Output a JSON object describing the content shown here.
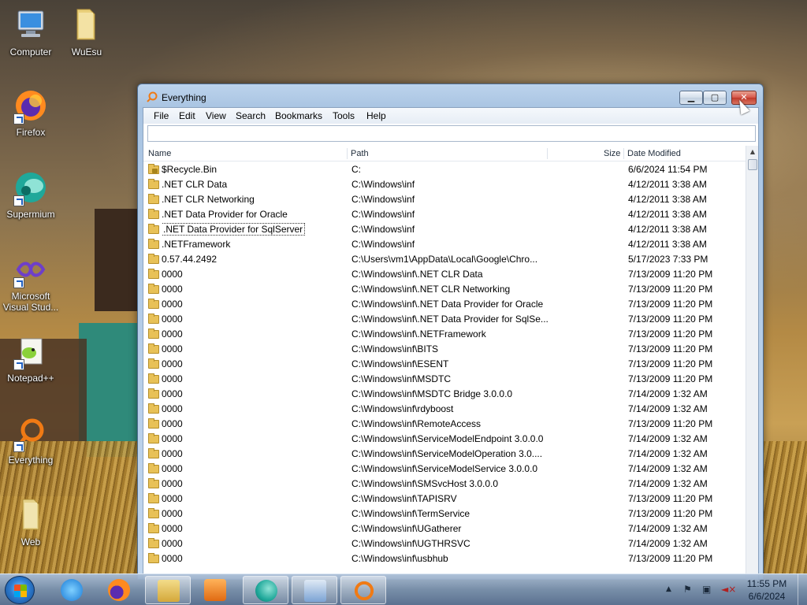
{
  "desktop": {
    "icons": [
      {
        "label": "Computer"
      },
      {
        "label": "WuEsu"
      },
      {
        "label": "Firefox"
      },
      {
        "label": "Supermium"
      },
      {
        "label": "Microsoft Visual Stud..."
      },
      {
        "label": "Notepad++"
      },
      {
        "label": "Everything"
      },
      {
        "label": "Web"
      }
    ]
  },
  "window": {
    "title": "Everything",
    "minimize_glyph": "▁",
    "maximize_glyph": "▢",
    "close_glyph": "✕",
    "menu": [
      "File",
      "Edit",
      "View",
      "Search",
      "Bookmarks",
      "Tools",
      "Help"
    ],
    "search": {
      "value": "",
      "placeholder": ""
    },
    "columns": {
      "name": "Name",
      "path": "Path",
      "size": "Size",
      "date": "Date Modified"
    },
    "rows": [
      {
        "name": "$Recycle.Bin",
        "path": "C:",
        "date": "6/6/2024 11:54 PM"
      },
      {
        "name": ".NET CLR Data",
        "path": "C:\\Windows\\inf",
        "date": "4/12/2011 3:38 AM"
      },
      {
        "name": ".NET CLR Networking",
        "path": "C:\\Windows\\inf",
        "date": "4/12/2011 3:38 AM"
      },
      {
        "name": ".NET Data Provider for Oracle",
        "path": "C:\\Windows\\inf",
        "date": "4/12/2011 3:38 AM"
      },
      {
        "name": ".NET Data Provider for SqlServer",
        "path": "C:\\Windows\\inf",
        "date": "4/12/2011 3:38 AM"
      },
      {
        "name": ".NETFramework",
        "path": "C:\\Windows\\inf",
        "date": "4/12/2011 3:38 AM"
      },
      {
        "name": "0.57.44.2492",
        "path": "C:\\Users\\vm1\\AppData\\Local\\Google\\Chro...",
        "date": "5/17/2023 7:33 PM"
      },
      {
        "name": "0000",
        "path": "C:\\Windows\\inf\\.NET CLR Data",
        "date": "7/13/2009 11:20 PM"
      },
      {
        "name": "0000",
        "path": "C:\\Windows\\inf\\.NET CLR Networking",
        "date": "7/13/2009 11:20 PM"
      },
      {
        "name": "0000",
        "path": "C:\\Windows\\inf\\.NET Data Provider for Oracle",
        "date": "7/13/2009 11:20 PM"
      },
      {
        "name": "0000",
        "path": "C:\\Windows\\inf\\.NET Data Provider for SqlSe...",
        "date": "7/13/2009 11:20 PM"
      },
      {
        "name": "0000",
        "path": "C:\\Windows\\inf\\.NETFramework",
        "date": "7/13/2009 11:20 PM"
      },
      {
        "name": "0000",
        "path": "C:\\Windows\\inf\\BITS",
        "date": "7/13/2009 11:20 PM"
      },
      {
        "name": "0000",
        "path": "C:\\Windows\\inf\\ESENT",
        "date": "7/13/2009 11:20 PM"
      },
      {
        "name": "0000",
        "path": "C:\\Windows\\inf\\MSDTC",
        "date": "7/13/2009 11:20 PM"
      },
      {
        "name": "0000",
        "path": "C:\\Windows\\inf\\MSDTC Bridge 3.0.0.0",
        "date": "7/14/2009 1:32 AM"
      },
      {
        "name": "0000",
        "path": "C:\\Windows\\inf\\rdyboost",
        "date": "7/14/2009 1:32 AM"
      },
      {
        "name": "0000",
        "path": "C:\\Windows\\inf\\RemoteAccess",
        "date": "7/13/2009 11:20 PM"
      },
      {
        "name": "0000",
        "path": "C:\\Windows\\inf\\ServiceModelEndpoint 3.0.0.0",
        "date": "7/14/2009 1:32 AM"
      },
      {
        "name": "0000",
        "path": "C:\\Windows\\inf\\ServiceModelOperation 3.0....",
        "date": "7/14/2009 1:32 AM"
      },
      {
        "name": "0000",
        "path": "C:\\Windows\\inf\\ServiceModelService 3.0.0.0",
        "date": "7/14/2009 1:32 AM"
      },
      {
        "name": "0000",
        "path": "C:\\Windows\\inf\\SMSvcHost 3.0.0.0",
        "date": "7/14/2009 1:32 AM"
      },
      {
        "name": "0000",
        "path": "C:\\Windows\\inf\\TAPISRV",
        "date": "7/13/2009 11:20 PM"
      },
      {
        "name": "0000",
        "path": "C:\\Windows\\inf\\TermService",
        "date": "7/13/2009 11:20 PM"
      },
      {
        "name": "0000",
        "path": "C:\\Windows\\inf\\UGatherer",
        "date": "7/14/2009 1:32 AM"
      },
      {
        "name": "0000",
        "path": "C:\\Windows\\inf\\UGTHRSVC",
        "date": "7/14/2009 1:32 AM"
      },
      {
        "name": "0000",
        "path": "C:\\Windows\\inf\\usbhub",
        "date": "7/13/2009 11:20 PM"
      }
    ],
    "focused_row_index": 4
  },
  "taskbar": {
    "clock_time": "11:55 PM",
    "clock_date": "6/6/2024",
    "tray_up_glyph": "▲",
    "tray_flag_glyph": "⚑",
    "tray_network_glyph": "▣",
    "tray_volume_glyph": "◄×"
  },
  "colors": {
    "selection_outline": "#333333",
    "close_button": "#c0392b",
    "folder": "#e8c157"
  }
}
